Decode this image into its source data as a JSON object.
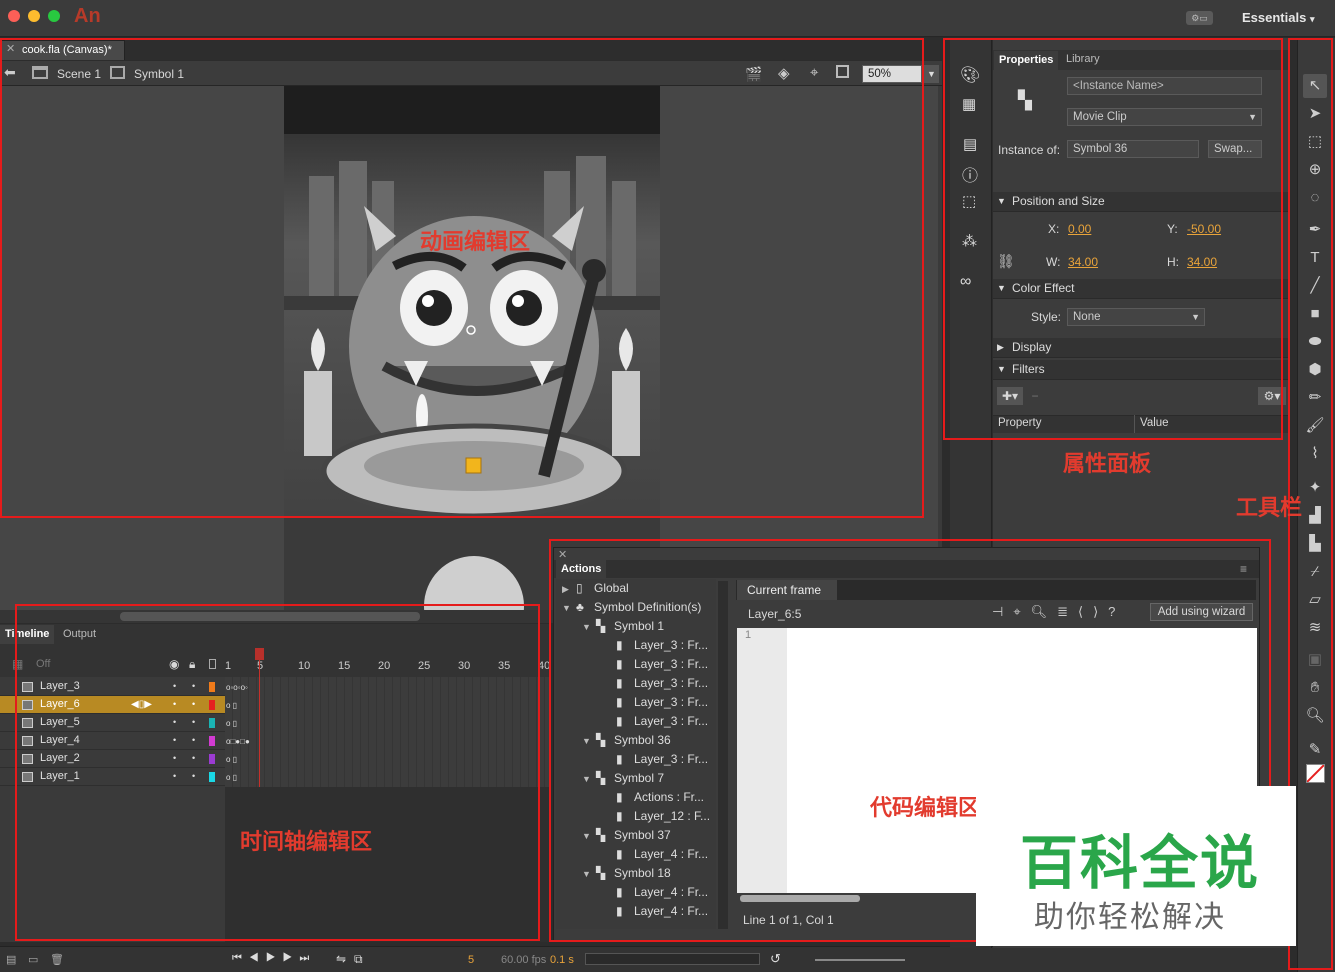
{
  "app": {
    "logo": "An",
    "workspace": "Essentials",
    "workspace_icon": "⚙▭"
  },
  "document": {
    "tab": "cook.fla (Canvas)*",
    "scene": "Scene 1",
    "symbol": "Symbol 1",
    "zoom": "50%"
  },
  "timeline": {
    "tabs": [
      "Timeline",
      "Output"
    ],
    "onion": "Off",
    "ruler": [
      "1",
      "5",
      "10",
      "15",
      "20",
      "25",
      "30",
      "35",
      "40"
    ],
    "layers": [
      {
        "name": "Layer_3",
        "color": "#f07b1a",
        "selected": false
      },
      {
        "name": "Layer_6",
        "color": "#e52020",
        "selected": true
      },
      {
        "name": "Layer_5",
        "color": "#1ab3b3",
        "selected": false
      },
      {
        "name": "Layer_4",
        "color": "#d23bd2",
        "selected": false
      },
      {
        "name": "Layer_2",
        "color": "#9b3bd2",
        "selected": false
      },
      {
        "name": "Layer_1",
        "color": "#1ad8e5",
        "selected": false
      }
    ],
    "current_frame": "5",
    "fps": "60.00 fps",
    "elapsed": "0.1 s"
  },
  "properties": {
    "tabs": [
      "Properties",
      "Library"
    ],
    "instance_name_placeholder": "<Instance Name>",
    "type": "Movie Clip",
    "instance_of_label": "Instance of:",
    "instance_of": "Symbol 36",
    "swap": "Swap...",
    "position_size": "Position and Size",
    "x_label": "X:",
    "x": "0.00",
    "y_label": "Y:",
    "y": "-50.00",
    "w_label": "W:",
    "w": "34.00",
    "h_label": "H:",
    "h": "34.00",
    "color_effect": "Color Effect",
    "style_label": "Style:",
    "style": "None",
    "display": "Display",
    "filters": "Filters",
    "col_property": "Property",
    "col_value": "Value"
  },
  "actions": {
    "title": "Actions",
    "tree": [
      {
        "label": "Global",
        "level": 0,
        "arrow": "▶"
      },
      {
        "label": "Symbol Definition(s)",
        "level": 0,
        "arrow": "▼"
      },
      {
        "label": "Symbol 1",
        "level": 1,
        "arrow": "▼"
      },
      {
        "label": "Layer_3 : Fr...",
        "level": 2,
        "arrow": ""
      },
      {
        "label": "Layer_3 : Fr...",
        "level": 2,
        "arrow": ""
      },
      {
        "label": "Layer_3 : Fr...",
        "level": 2,
        "arrow": ""
      },
      {
        "label": "Layer_3 : Fr...",
        "level": 2,
        "arrow": ""
      },
      {
        "label": "Layer_3 : Fr...",
        "level": 2,
        "arrow": ""
      },
      {
        "label": "Symbol 36",
        "level": 1,
        "arrow": "▼"
      },
      {
        "label": "Layer_3 : Fr...",
        "level": 2,
        "arrow": ""
      },
      {
        "label": "Symbol 7",
        "level": 1,
        "arrow": "▼"
      },
      {
        "label": "Actions : Fr...",
        "level": 2,
        "arrow": ""
      },
      {
        "label": "Layer_12 : F...",
        "level": 2,
        "arrow": ""
      },
      {
        "label": "Symbol 37",
        "level": 1,
        "arrow": "▼"
      },
      {
        "label": "Layer_4 : Fr...",
        "level": 2,
        "arrow": ""
      },
      {
        "label": "Symbol 18",
        "level": 1,
        "arrow": "▼"
      },
      {
        "label": "Layer_4 : Fr...",
        "level": 2,
        "arrow": ""
      },
      {
        "label": "Layer_4 : Fr...",
        "level": 2,
        "arrow": ""
      }
    ],
    "current_frame_tab": "Current frame",
    "frame_ref": "Layer_6:5",
    "add_wizard": "Add using wizard",
    "line_no": "1",
    "status": "Line 1 of 1, Col 1"
  },
  "annotations": {
    "animation_area": "动画编辑区",
    "properties_panel": "属性面板",
    "toolbar": "工具栏",
    "timeline_area": "时间轴编辑区",
    "code_area": "代码编辑区"
  },
  "watermark": {
    "title": "百科全说",
    "subtitle": "助你轻松解决"
  }
}
